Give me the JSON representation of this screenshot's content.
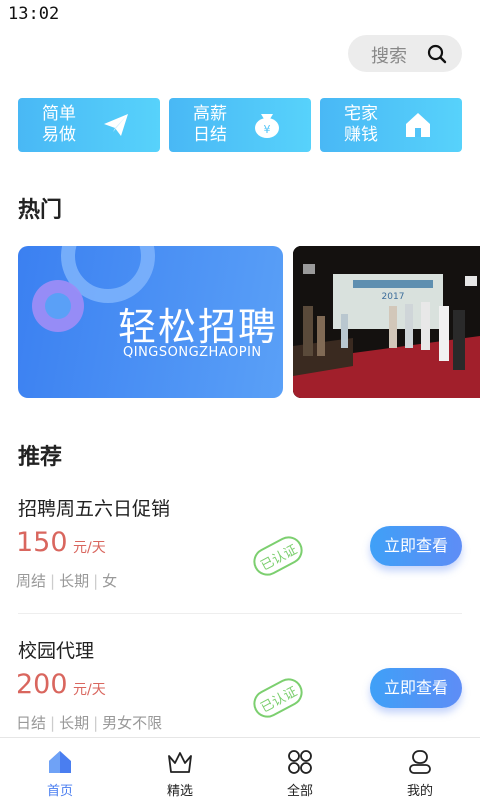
{
  "status_bar": {
    "time": "13:02"
  },
  "search": {
    "label": "搜索",
    "icon": "search-icon"
  },
  "quick_actions": [
    {
      "line1": "简单",
      "line2": "易做",
      "icon": "paper-plane-icon"
    },
    {
      "line1": "高薪",
      "line2": "日结",
      "icon": "money-bag-icon"
    },
    {
      "line1": "宅家",
      "line2": "赚钱",
      "icon": "home-icon"
    }
  ],
  "hot": {
    "title": "热门",
    "banner": {
      "title": "轻松招聘",
      "subtitle": "QINGSONGZHAOPIN"
    },
    "photo": {
      "sign_text": "2017"
    }
  },
  "recommend": {
    "title": "推荐",
    "jobs": [
      {
        "name": "招聘周五六日促销",
        "price": "150",
        "unit": "元/天",
        "tags": [
          "周结",
          "长期",
          "女"
        ],
        "stamp": "已认证",
        "action": "立即查看"
      },
      {
        "name": "校园代理",
        "price": "200",
        "unit": "元/天",
        "tags": [
          "日结",
          "长期",
          "男女不限"
        ],
        "stamp": "已认证",
        "action": "立即查看"
      }
    ]
  },
  "tabbar": {
    "active_color": "#4a7ef0",
    "tabs": [
      {
        "label": "首页",
        "icon": "home-tab-icon"
      },
      {
        "label": "精选",
        "icon": "crown-icon"
      },
      {
        "label": "全部",
        "icon": "all-grid-icon"
      },
      {
        "label": "我的",
        "icon": "user-icon"
      }
    ]
  }
}
